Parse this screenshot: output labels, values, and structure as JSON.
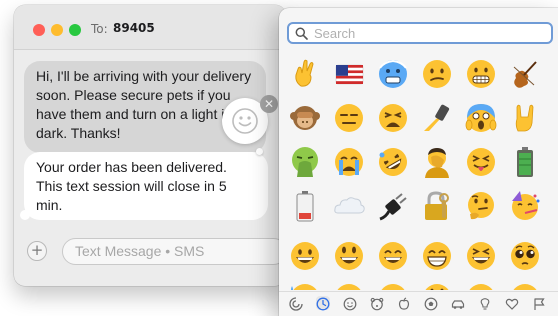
{
  "window": {
    "to_label": "To:",
    "to_value": "89405"
  },
  "messages": [
    {
      "text": "Hi, I'll be arriving with your delivery soon. Please secure pets if you have them and turn on a light if it's dark. Thanks!",
      "style": "received-selected"
    },
    {
      "text": "Your order has been delivered. This text session will close in 5 min.",
      "style": "received"
    }
  ],
  "compose": {
    "placeholder": "Text Message • SMS"
  },
  "tapback": {
    "icon": "smiley-face-icon",
    "close_icon": "close-icon"
  },
  "emoji_picker": {
    "search_placeholder": "Search",
    "rows": [
      [
        "crossed-fingers",
        "us-flag",
        "cold-face",
        "confused-face",
        "grimacing-face",
        "violin"
      ],
      [
        "see-no-evil-monkey",
        "expressionless-face",
        "weary-face",
        "selfie",
        "screaming-face",
        "rock-on-hand"
      ],
      [
        "vomiting-face",
        "crying-face",
        "rofl-face",
        "facepalm-person",
        "squinting-tongue-face",
        "battery-full"
      ],
      [
        "battery-low",
        "cloud",
        "electric-plug",
        "locked-with-key",
        "thinking-face",
        "party-face"
      ],
      [
        "grinning-face",
        "smiley-face",
        "grin-face",
        "beaming-face",
        "laughing-face",
        "pleading-face"
      ],
      [
        "sweat-smile-face",
        "joy-face",
        "rofl-face",
        "smiley-face",
        "blush-face",
        "slight-smile-face"
      ]
    ],
    "categories": [
      {
        "name": "frequently-used-icon",
        "active": false
      },
      {
        "name": "recent-clock-icon",
        "active": true
      },
      {
        "name": "smileys-people-icon",
        "active": false
      },
      {
        "name": "animals-nature-icon",
        "active": false
      },
      {
        "name": "food-drink-icon",
        "active": false
      },
      {
        "name": "activity-ball-icon",
        "active": false
      },
      {
        "name": "travel-car-icon",
        "active": false
      },
      {
        "name": "objects-bulb-icon",
        "active": false
      },
      {
        "name": "symbols-heart-icon",
        "active": false
      },
      {
        "name": "flags-icon",
        "active": false
      }
    ],
    "colors": {
      "accent": "#6f9bd6",
      "emoji_yellow": "#fcc232",
      "recent_blue": "#3478f6"
    }
  }
}
